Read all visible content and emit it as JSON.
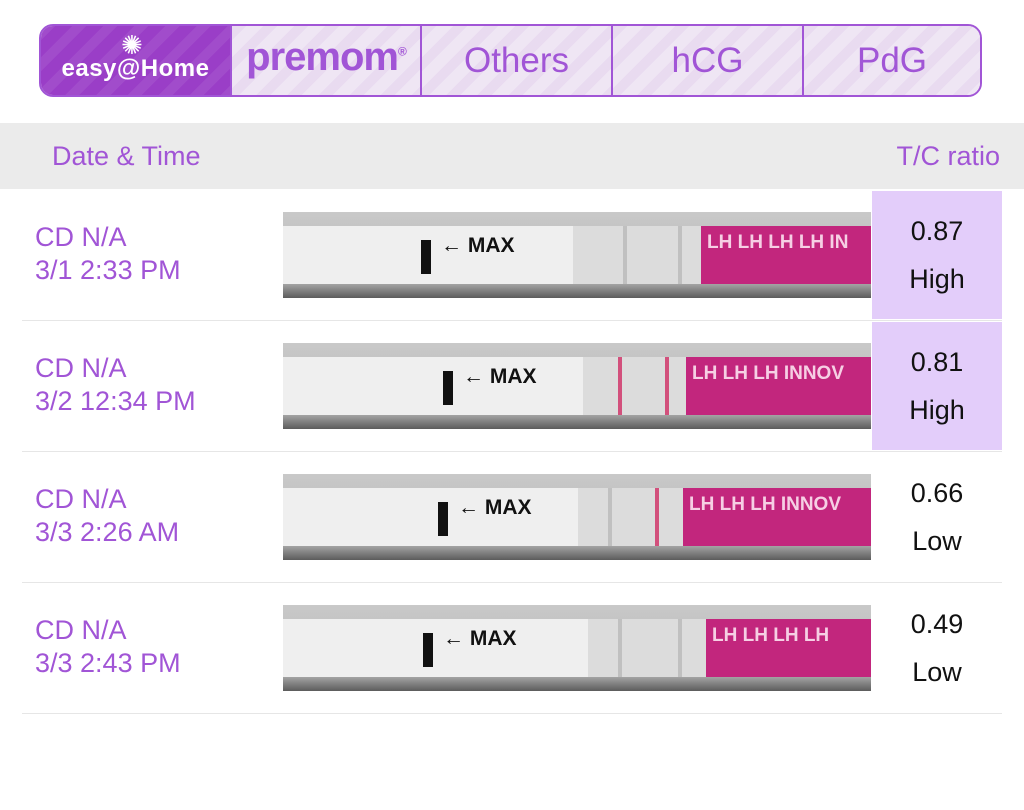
{
  "tabs": {
    "easy": {
      "label": "easy@Home"
    },
    "premom": {
      "label": "premom",
      "reg": "®"
    },
    "others": {
      "label": "Others"
    },
    "hcg": {
      "label": "hCG"
    },
    "pdg": {
      "label": "PdG"
    }
  },
  "header": {
    "date_time": "Date & Time",
    "ratio": "T/C ratio"
  },
  "rows": [
    {
      "cd": "CD N/A",
      "datetime": "3/1 2:33 PM",
      "ratio": "0.87",
      "level": "High",
      "strip_text": "LH LH LH LH IN",
      "max_label": "← MAX"
    },
    {
      "cd": "CD N/A",
      "datetime": "3/2 12:34 PM",
      "ratio": "0.81",
      "level": "High",
      "strip_text": "LH LH LH INNOV",
      "max_label": "← MAX"
    },
    {
      "cd": "CD N/A",
      "datetime": "3/3 2:26 AM",
      "ratio": "0.66",
      "level": "Low",
      "strip_text": "LH LH LH INNOV",
      "max_label": "← MAX"
    },
    {
      "cd": "CD N/A",
      "datetime": "3/3 2:43 PM",
      "ratio": "0.49",
      "level": "Low",
      "strip_text": "LH LH LH LH",
      "max_label": "← MAX"
    }
  ],
  "colors": {
    "accent": "#a155d6",
    "high_bg": "#e3cdfa",
    "strip_pink": "#c2267d"
  }
}
